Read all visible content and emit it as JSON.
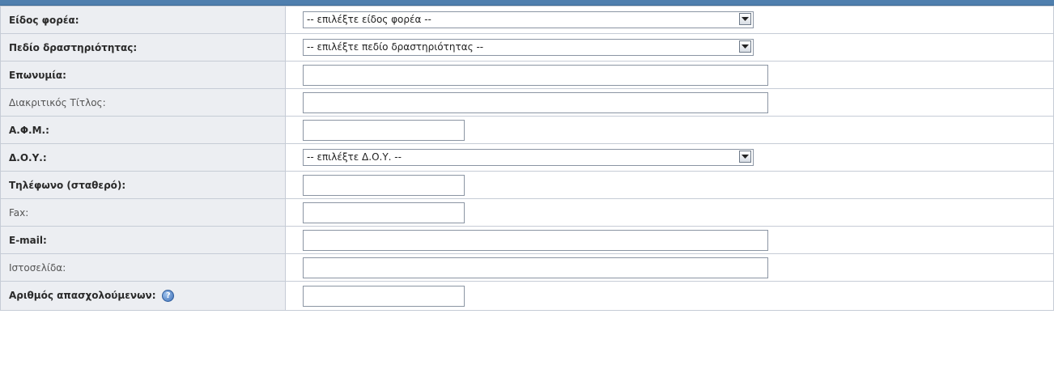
{
  "form": {
    "rows": [
      {
        "label": "Είδος φορέα:",
        "required": true,
        "type": "select",
        "value": "-- επιλέξτε είδος φορέα --"
      },
      {
        "label": "Πεδίο δραστηριότητας:",
        "required": true,
        "type": "select",
        "value": "-- επιλέξτε πεδίο δραστηριότητας --"
      },
      {
        "label": "Επωνυμία:",
        "required": true,
        "type": "text",
        "value": ""
      },
      {
        "label": "Διακριτικός Τίτλος:",
        "required": false,
        "type": "text",
        "value": ""
      },
      {
        "label": "Α.Φ.Μ.:",
        "required": true,
        "type": "text",
        "value": ""
      },
      {
        "label": "Δ.Ο.Υ.:",
        "required": true,
        "type": "select",
        "value": "-- επιλέξτε Δ.Ο.Υ. --"
      },
      {
        "label": "Τηλέφωνο (σταθερό):",
        "required": true,
        "type": "text",
        "value": ""
      },
      {
        "label": "Fax:",
        "required": false,
        "type": "text",
        "value": ""
      },
      {
        "label": "E-mail:",
        "required": true,
        "type": "text",
        "value": ""
      },
      {
        "label": "Ιστοσελίδα:",
        "required": false,
        "type": "text",
        "value": ""
      },
      {
        "label": "Αριθμός απασχολούμενων:",
        "required": true,
        "type": "text",
        "value": "",
        "help_icon": "help-icon"
      }
    ]
  },
  "colors": {
    "header_bar": "#4f7fae",
    "label_bg": "#eceef2",
    "border": "#c6ccd6"
  }
}
